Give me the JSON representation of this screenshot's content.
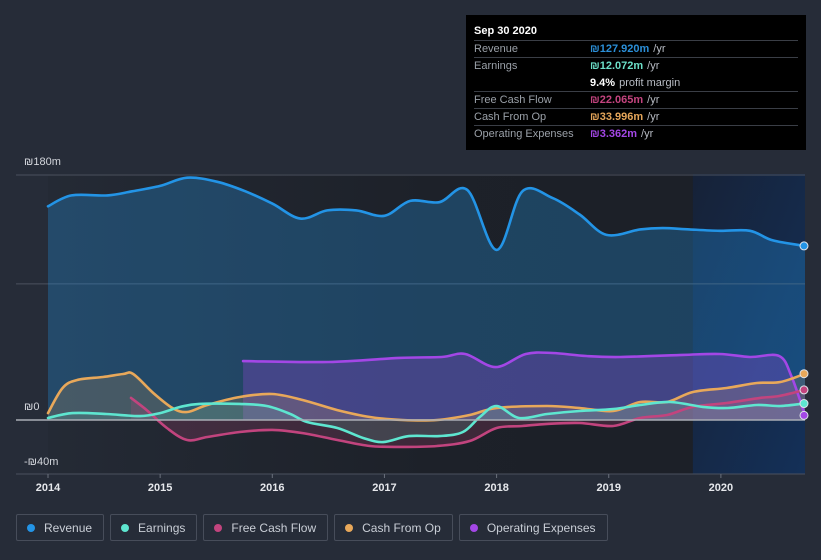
{
  "tooltip": {
    "date": "Sep 30 2020",
    "rows": [
      {
        "label": "Revenue",
        "value": "₪127.920m",
        "unit": "/yr",
        "color": "#2b8fd8"
      },
      {
        "label": "Earnings",
        "value": "₪12.072m",
        "unit": "/yr",
        "color": "#6ce0c9"
      },
      {
        "label": "",
        "value": "9.4%",
        "unit": "profit margin",
        "color": "#ffffff"
      },
      {
        "label": "Free Cash Flow",
        "value": "₪22.065m",
        "unit": "/yr",
        "color": "#c4447f"
      },
      {
        "label": "Cash From Op",
        "value": "₪33.996m",
        "unit": "/yr",
        "color": "#e6a65a"
      },
      {
        "label": "Operating Expenses",
        "value": "₪3.362m",
        "unit": "/yr",
        "color": "#a347e6"
      }
    ]
  },
  "legend": [
    {
      "label": "Revenue",
      "color": "#2394e6"
    },
    {
      "label": "Earnings",
      "color": "#5ee6d0"
    },
    {
      "label": "Free Cash Flow",
      "color": "#c2447e"
    },
    {
      "label": "Cash From Op",
      "color": "#e8a85a"
    },
    {
      "label": "Operating Expenses",
      "color": "#a347e6"
    }
  ],
  "chart_data": {
    "type": "area",
    "title": "",
    "xlabel": "",
    "ylabel": "",
    "currency": "₪",
    "unit": "m",
    "xlim": [
      2014.0,
      2020.75
    ],
    "ylim": [
      -40,
      180
    ],
    "y_tick_labels": [
      {
        "value": 180,
        "label": "₪180m"
      },
      {
        "value": 0,
        "label": "₪0"
      },
      {
        "value": -40,
        "label": "-₪40m"
      }
    ],
    "gridlines": [
      180,
      100
    ],
    "x_ticks": [
      {
        "value": 2014,
        "label": "2014"
      },
      {
        "value": 2015,
        "label": "2015"
      },
      {
        "value": 2016,
        "label": "2016"
      },
      {
        "value": 2017,
        "label": "2017"
      },
      {
        "value": 2018,
        "label": "2018"
      },
      {
        "value": 2019,
        "label": "2019"
      },
      {
        "value": 2020,
        "label": "2020"
      }
    ],
    "highlight_range": [
      2019.75,
      2020.75
    ],
    "legend_position": "bottom-left",
    "series": [
      {
        "name": "Revenue",
        "key": "revenue",
        "color": "#2394e6",
        "fill_opacity": 0.3,
        "points": [
          [
            2014.0,
            157
          ],
          [
            2014.21,
            165
          ],
          [
            2014.53,
            165
          ],
          [
            2014.75,
            168
          ],
          [
            2015.0,
            172
          ],
          [
            2015.24,
            178
          ],
          [
            2015.51,
            175
          ],
          [
            2015.76,
            168
          ],
          [
            2016.0,
            159
          ],
          [
            2016.25,
            148
          ],
          [
            2016.49,
            154
          ],
          [
            2016.75,
            154
          ],
          [
            2017.0,
            150
          ],
          [
            2017.23,
            161
          ],
          [
            2017.49,
            160
          ],
          [
            2017.74,
            169
          ],
          [
            2018.0,
            125
          ],
          [
            2018.23,
            168
          ],
          [
            2018.5,
            163
          ],
          [
            2018.74,
            151
          ],
          [
            2018.98,
            136
          ],
          [
            2019.28,
            140
          ],
          [
            2019.48,
            141
          ],
          [
            2019.72,
            140
          ],
          [
            2019.99,
            139
          ],
          [
            2020.26,
            139
          ],
          [
            2020.46,
            132
          ],
          [
            2020.75,
            127.9
          ]
        ]
      },
      {
        "name": "Operating Expenses",
        "key": "opex",
        "color": "#a347e6",
        "fill_opacity": 0.28,
        "points": [
          [
            2015.74,
            43.3
          ],
          [
            2016.5,
            42.6
          ],
          [
            2017.13,
            45.6
          ],
          [
            2017.51,
            46.3
          ],
          [
            2017.72,
            48.5
          ],
          [
            2017.99,
            38.9
          ],
          [
            2018.26,
            48.5
          ],
          [
            2018.5,
            49.2
          ],
          [
            2018.8,
            47.0
          ],
          [
            2019.1,
            46.3
          ],
          [
            2019.66,
            47.8
          ],
          [
            2019.99,
            48.5
          ],
          [
            2020.26,
            46.3
          ],
          [
            2020.52,
            47.0
          ],
          [
            2020.63,
            32.0
          ],
          [
            2020.75,
            3.4
          ]
        ]
      },
      {
        "name": "Cash From Op",
        "key": "cfo",
        "color": "#e8a85a",
        "fill_opacity": 0.18,
        "points": [
          [
            2014.0,
            5.1
          ],
          [
            2014.13,
            23.5
          ],
          [
            2014.26,
            29.4
          ],
          [
            2014.49,
            31.6
          ],
          [
            2014.67,
            33.8
          ],
          [
            2014.76,
            33.8
          ],
          [
            2014.94,
            19.8
          ],
          [
            2015.11,
            8.8
          ],
          [
            2015.24,
            5.9
          ],
          [
            2015.42,
            11.0
          ],
          [
            2015.71,
            16.9
          ],
          [
            2016.0,
            19.1
          ],
          [
            2016.27,
            14.7
          ],
          [
            2016.58,
            7.3
          ],
          [
            2016.87,
            2.2
          ],
          [
            2017.16,
            0.0
          ],
          [
            2017.47,
            0.0
          ],
          [
            2017.76,
            3.7
          ],
          [
            2018.0,
            8.8
          ],
          [
            2018.45,
            10.3
          ],
          [
            2018.74,
            8.8
          ],
          [
            2019.04,
            6.6
          ],
          [
            2019.28,
            13.2
          ],
          [
            2019.52,
            13.2
          ],
          [
            2019.75,
            20.6
          ],
          [
            2020.05,
            23.5
          ],
          [
            2020.32,
            27.2
          ],
          [
            2020.53,
            27.9
          ],
          [
            2020.75,
            34.0
          ]
        ]
      },
      {
        "name": "Free Cash Flow",
        "key": "fcf",
        "color": "#c2447e",
        "fill_opacity": 0.2,
        "points": [
          [
            2014.74,
            16.2
          ],
          [
            2014.88,
            7.3
          ],
          [
            2015.06,
            -5.9
          ],
          [
            2015.24,
            -14.7
          ],
          [
            2015.42,
            -12.5
          ],
          [
            2015.71,
            -8.8
          ],
          [
            2016.0,
            -7.3
          ],
          [
            2016.27,
            -9.6
          ],
          [
            2016.58,
            -14.7
          ],
          [
            2016.87,
            -19.1
          ],
          [
            2017.16,
            -19.8
          ],
          [
            2017.47,
            -19.1
          ],
          [
            2017.76,
            -15.4
          ],
          [
            2018.0,
            -5.9
          ],
          [
            2018.23,
            -4.4
          ],
          [
            2018.45,
            -2.9
          ],
          [
            2018.74,
            -2.2
          ],
          [
            2019.04,
            -4.4
          ],
          [
            2019.28,
            1.5
          ],
          [
            2019.52,
            3.7
          ],
          [
            2019.75,
            9.6
          ],
          [
            2020.05,
            12.5
          ],
          [
            2020.35,
            16.2
          ],
          [
            2020.52,
            17.6
          ],
          [
            2020.75,
            22.1
          ]
        ]
      },
      {
        "name": "Earnings",
        "key": "earnings",
        "color": "#5ee6d0",
        "fill_opacity": 0.14,
        "points": [
          [
            2014.0,
            1.5
          ],
          [
            2014.22,
            5.1
          ],
          [
            2014.52,
            4.4
          ],
          [
            2014.82,
            2.9
          ],
          [
            2015.0,
            5.1
          ],
          [
            2015.18,
            9.6
          ],
          [
            2015.35,
            11.8
          ],
          [
            2015.71,
            11.8
          ],
          [
            2015.95,
            10.3
          ],
          [
            2016.16,
            4.5
          ],
          [
            2016.31,
            -1.5
          ],
          [
            2016.58,
            -5.9
          ],
          [
            2016.81,
            -13.2
          ],
          [
            2016.99,
            -16.2
          ],
          [
            2017.22,
            -11.8
          ],
          [
            2017.49,
            -11.8
          ],
          [
            2017.7,
            -8.8
          ],
          [
            2017.85,
            2.2
          ],
          [
            2018.0,
            10.3
          ],
          [
            2018.2,
            1.5
          ],
          [
            2018.45,
            4.4
          ],
          [
            2018.74,
            6.6
          ],
          [
            2019.04,
            8.0
          ],
          [
            2019.28,
            11.0
          ],
          [
            2019.55,
            13.2
          ],
          [
            2019.84,
            9.6
          ],
          [
            2020.06,
            8.8
          ],
          [
            2020.32,
            11.0
          ],
          [
            2020.53,
            10.3
          ],
          [
            2020.75,
            12.1
          ]
        ]
      }
    ]
  }
}
